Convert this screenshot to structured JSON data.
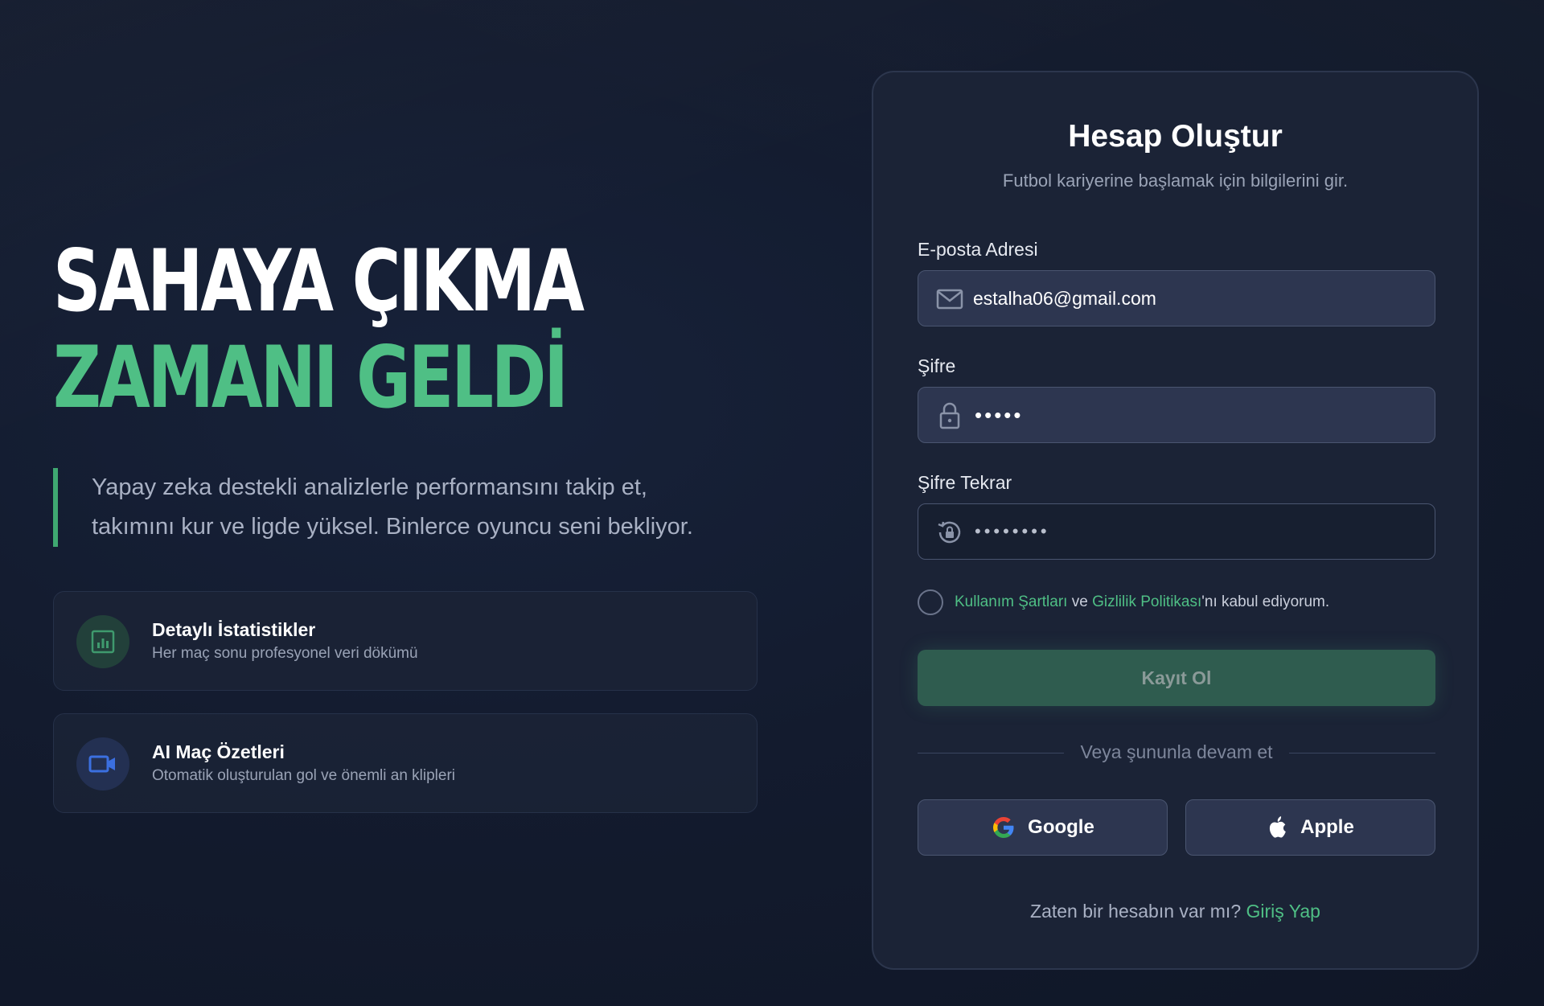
{
  "hero": {
    "title_line1": "SAHAYA ÇIKMA",
    "title_line2": "ZAMANI GELDİ",
    "tagline_line1": "Yapay zeka destekli analizlerle performansını takip et,",
    "tagline_line2": "takımını kur ve ligde yüksel. Binlerce oyuncu seni bekliyor."
  },
  "features": [
    {
      "title": "Detaylı İstatistikler",
      "desc": "Her maç sonu profesyonel veri dökümü",
      "icon": "chart-icon"
    },
    {
      "title": "AI Maç Özetleri",
      "desc": "Otomatik oluşturulan gol ve önemli an klipleri",
      "icon": "video-camera-icon"
    }
  ],
  "form": {
    "title": "Hesap Oluştur",
    "subtitle": "Futbol kariyerine başlamak için bilgilerini gir.",
    "email_label": "E-posta Adresi",
    "email_value": "estalha06@gmail.com",
    "password_label": "Şifre",
    "password_mask": "•••••",
    "password_repeat_label": "Şifre Tekrar",
    "password_repeat_mask": "••••••••",
    "terms_link1": "Kullanım Şartları",
    "terms_and": " ve ",
    "terms_link2": "Gizlilik Politikası",
    "terms_rest": "'nı kabul ediyorum.",
    "submit_label": "Kayıt Ol",
    "divider_text": "Veya şununla devam et",
    "google_label": "Google",
    "apple_label": "Apple",
    "have_account": "Zaten bir hesabın var mı?",
    "signin_link": "Giriş Yap"
  },
  "colors": {
    "accent": "#4fbf85",
    "background": "#131b2e",
    "card": "#1b2336",
    "submit_disabled": "#2f5c4f"
  }
}
